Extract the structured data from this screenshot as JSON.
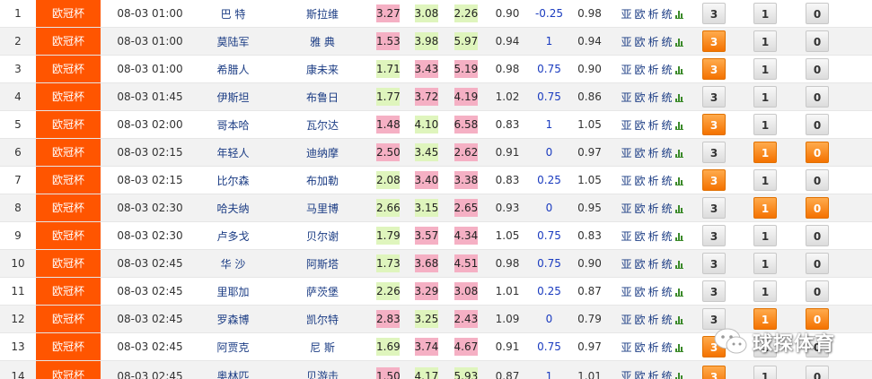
{
  "link_labels": [
    "亚",
    "欧",
    "析",
    "统"
  ],
  "colors": {
    "league_bg": "#ff5500",
    "team_text": "#1b3c84",
    "odds_pink": "#f5b0c4",
    "odds_green": "#dff5bd",
    "handicap_blue": "#1a3bbf",
    "button_active": "#f47200"
  },
  "icons": {
    "chart": "bar-chart-icon",
    "watermark": "wechat-icon"
  },
  "watermark": {
    "text": "球探体育"
  },
  "matches": [
    {
      "no": "1",
      "league": "欧冠杯",
      "time": "08-03 01:00",
      "home": "巴 特",
      "away": "斯拉维",
      "o1": "3.27",
      "o2": "3.08",
      "o3": "2.26",
      "c1": "p",
      "c2": "g",
      "c3": "g",
      "a1": "0.90",
      "hc": "-0.25",
      "a2": "0.98",
      "b1": "3",
      "b2": "1",
      "b3": "0",
      "s1": 0,
      "s2": 0,
      "s3": 0
    },
    {
      "no": "2",
      "league": "欧冠杯",
      "time": "08-03 01:00",
      "home": "莫陆军",
      "away": "雅 典",
      "o1": "1.53",
      "o2": "3.98",
      "o3": "5.97",
      "c1": "p",
      "c2": "g",
      "c3": "g",
      "a1": "0.94",
      "hc": "1",
      "a2": "0.94",
      "b1": "3",
      "b2": "1",
      "b3": "0",
      "s1": 1,
      "s2": 0,
      "s3": 0
    },
    {
      "no": "3",
      "league": "欧冠杯",
      "time": "08-03 01:00",
      "home": "希腊人",
      "away": "康未来",
      "o1": "1.71",
      "o2": "3.43",
      "o3": "5.19",
      "c1": "g",
      "c2": "p",
      "c3": "p",
      "a1": "0.98",
      "hc": "0.75",
      "a2": "0.90",
      "b1": "3",
      "b2": "1",
      "b3": "0",
      "s1": 1,
      "s2": 0,
      "s3": 0
    },
    {
      "no": "4",
      "league": "欧冠杯",
      "time": "08-03 01:45",
      "home": "伊斯坦",
      "away": "布鲁日",
      "o1": "1.77",
      "o2": "3.72",
      "o3": "4.19",
      "c1": "g",
      "c2": "p",
      "c3": "p",
      "a1": "1.02",
      "hc": "0.75",
      "a2": "0.86",
      "b1": "3",
      "b2": "1",
      "b3": "0",
      "s1": 0,
      "s2": 0,
      "s3": 0
    },
    {
      "no": "5",
      "league": "欧冠杯",
      "time": "08-03 02:00",
      "home": "哥本哈",
      "away": "瓦尔达",
      "o1": "1.48",
      "o2": "4.10",
      "o3": "6.58",
      "c1": "p",
      "c2": "g",
      "c3": "p",
      "a1": "0.83",
      "hc": "1",
      "a2": "1.05",
      "b1": "3",
      "b2": "1",
      "b3": "0",
      "s1": 1,
      "s2": 0,
      "s3": 0
    },
    {
      "no": "6",
      "league": "欧冠杯",
      "time": "08-03 02:15",
      "home": "年轻人",
      "away": "迪纳摩",
      "o1": "2.50",
      "o2": "3.45",
      "o3": "2.62",
      "c1": "p",
      "c2": "g",
      "c3": "p",
      "a1": "0.91",
      "hc": "0",
      "a2": "0.97",
      "b1": "3",
      "b2": "1",
      "b3": "0",
      "s1": 0,
      "s2": 1,
      "s3": 1
    },
    {
      "no": "7",
      "league": "欧冠杯",
      "time": "08-03 02:15",
      "home": "比尔森",
      "away": "布加勒",
      "o1": "2.08",
      "o2": "3.40",
      "o3": "3.38",
      "c1": "g",
      "c2": "p",
      "c3": "p",
      "a1": "0.83",
      "hc": "0.25",
      "a2": "1.05",
      "b1": "3",
      "b2": "1",
      "b3": "0",
      "s1": 1,
      "s2": 0,
      "s3": 0
    },
    {
      "no": "8",
      "league": "欧冠杯",
      "time": "08-03 02:30",
      "home": "哈夫纳",
      "away": "马里博",
      "o1": "2.66",
      "o2": "3.15",
      "o3": "2.65",
      "c1": "g",
      "c2": "g",
      "c3": "p",
      "a1": "0.93",
      "hc": "0",
      "a2": "0.95",
      "b1": "3",
      "b2": "1",
      "b3": "0",
      "s1": 0,
      "s2": 1,
      "s3": 1
    },
    {
      "no": "9",
      "league": "欧冠杯",
      "time": "08-03 02:30",
      "home": "卢多戈",
      "away": "贝尔谢",
      "o1": "1.79",
      "o2": "3.57",
      "o3": "4.34",
      "c1": "g",
      "c2": "p",
      "c3": "p",
      "a1": "1.05",
      "hc": "0.75",
      "a2": "0.83",
      "b1": "3",
      "b2": "1",
      "b3": "0",
      "s1": 0,
      "s2": 0,
      "s3": 0
    },
    {
      "no": "10",
      "league": "欧冠杯",
      "time": "08-03 02:45",
      "home": "华 沙",
      "away": "阿斯塔",
      "o1": "1.73",
      "o2": "3.68",
      "o3": "4.51",
      "c1": "g",
      "c2": "p",
      "c3": "p",
      "a1": "0.98",
      "hc": "0.75",
      "a2": "0.90",
      "b1": "3",
      "b2": "1",
      "b3": "0",
      "s1": 0,
      "s2": 0,
      "s3": 0
    },
    {
      "no": "11",
      "league": "欧冠杯",
      "time": "08-03 02:45",
      "home": "里耶加",
      "away": "萨茨堡",
      "o1": "2.26",
      "o2": "3.29",
      "o3": "3.08",
      "c1": "g",
      "c2": "p",
      "c3": "p",
      "a1": "1.01",
      "hc": "0.25",
      "a2": "0.87",
      "b1": "3",
      "b2": "1",
      "b3": "0",
      "s1": 0,
      "s2": 0,
      "s3": 0
    },
    {
      "no": "12",
      "league": "欧冠杯",
      "time": "08-03 02:45",
      "home": "罗森博",
      "away": "凯尔特",
      "o1": "2.83",
      "o2": "3.25",
      "o3": "2.43",
      "c1": "p",
      "c2": "g",
      "c3": "p",
      "a1": "1.09",
      "hc": "0",
      "a2": "0.79",
      "b1": "3",
      "b2": "1",
      "b3": "0",
      "s1": 0,
      "s2": 1,
      "s3": 1
    },
    {
      "no": "13",
      "league": "欧冠杯",
      "time": "08-03 02:45",
      "home": "阿贾克",
      "away": "尼 斯",
      "o1": "1.69",
      "o2": "3.74",
      "o3": "4.67",
      "c1": "g",
      "c2": "p",
      "c3": "p",
      "a1": "0.91",
      "hc": "0.75",
      "a2": "0.97",
      "b1": "3",
      "b2": "1",
      "b3": "0",
      "s1": 1,
      "s2": 0,
      "s3": 0
    },
    {
      "no": "14",
      "league": "欧冠杯",
      "time": "08-03 02:45",
      "home": "奥林匹",
      "away": "贝游击",
      "o1": "1.50",
      "o2": "4.17",
      "o3": "5.93",
      "c1": "p",
      "c2": "g",
      "c3": "g",
      "a1": "0.87",
      "hc": "1",
      "a2": "1.01",
      "b1": "3",
      "b2": "1",
      "b3": "0",
      "s1": 1,
      "s2": 0,
      "s3": 0
    }
  ]
}
